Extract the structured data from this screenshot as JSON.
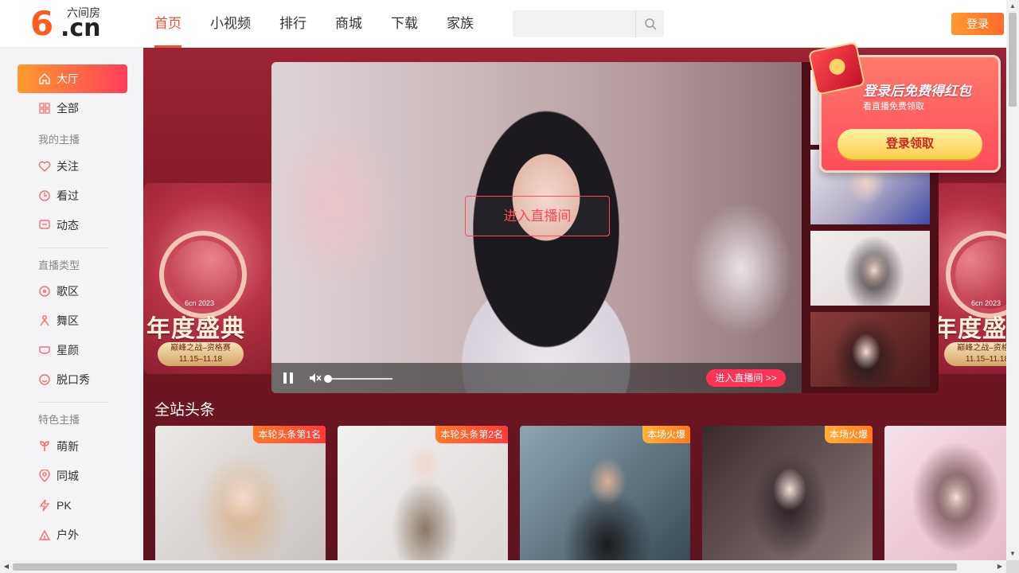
{
  "header": {
    "logo_main": "6",
    "logo_cn": ".cn",
    "logo_sub": "六间房",
    "nav": [
      "首页",
      "小视频",
      "排行",
      "商城",
      "下载",
      "家族"
    ],
    "search_placeholder": "",
    "login_label": "登录"
  },
  "sidebar": {
    "hall": "大厅",
    "all": "全部",
    "my_anchor_heading": "我的主播",
    "follow": "关注",
    "watched": "看过",
    "feed": "动态",
    "live_type_heading": "直播类型",
    "song": "歌区",
    "dance": "舞区",
    "beauty": "星颜",
    "talk": "脱口秀",
    "feature_heading": "特色主播",
    "newbie": "萌新",
    "nearby": "同城",
    "pk": "PK",
    "outdoor": "户外"
  },
  "banner": {
    "event_title": "年度盛典",
    "event_year": "6cn 2023",
    "event_tag_line1": "巅峰之战–资格赛",
    "event_tag_line2": "11.15–11.18"
  },
  "player": {
    "enter_box": "进入直播间",
    "enter_live": "进入直播间 >>",
    "volume": 0
  },
  "promo": {
    "title": "登录后免费得红包",
    "subtitle": "看直播免费领取",
    "button": "登录领取"
  },
  "section": {
    "title": "全站头条",
    "cards": [
      {
        "badge": "本轮头条第1名"
      },
      {
        "badge": "本轮头条第2名"
      },
      {
        "badge": "本场火爆"
      },
      {
        "badge": "本场火爆"
      },
      {
        "badge": ""
      }
    ]
  },
  "colors": {
    "accent": "#f0503a",
    "hero_bg": "#7d1826",
    "badge_red": "#ff3a3a",
    "badge_orange": "#ff7a1a"
  }
}
